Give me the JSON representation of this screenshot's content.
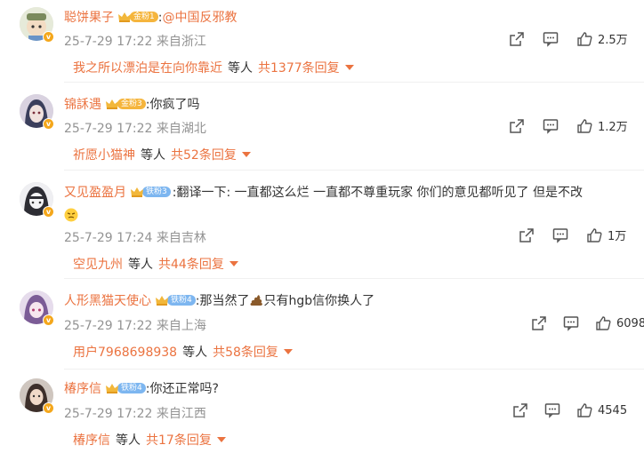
{
  "comments": [
    {
      "username": "聪饼果子",
      "fan_label": "金粉1",
      "fan_type": "gold",
      "text_prefix": ":",
      "mention": "@中国反邪教",
      "text_rest": "",
      "meta": "25-7-29 17:22 来自浙江",
      "likes": "2.5万",
      "reply_user": "我之所以漂泊是在向你靠近",
      "reply_mid": "等人",
      "reply_count": "共1377条回复",
      "avatar_color": "#b8c7a5",
      "badge": "gold"
    },
    {
      "username": "锦訸遇",
      "fan_label": "金粉3",
      "fan_type": "gold",
      "text_prefix": ":你疯了吗",
      "mention": "",
      "text_rest": "",
      "meta": "25-7-29 17:22 来自湖北",
      "likes": "1.2万",
      "reply_user": "祈愿小猫神",
      "reply_mid": "等人",
      "reply_count": "共52条回复",
      "avatar_color": "#3b3f5c",
      "badge": "gold"
    },
    {
      "username": "又见盈盈月",
      "fan_label": "铁粉3",
      "fan_type": "iron",
      "text_prefix": ":翻译一下:  一直都这么烂  一直都不尊重玩家  你们的意见都听见了  但是不改",
      "mention": "",
      "text_rest": "",
      "meta": "25-7-29 17:24 来自吉林",
      "likes": "1万",
      "reply_user": "空见九州",
      "reply_mid": "等人",
      "reply_count": "共44条回复",
      "avatar_color": "#cfcfd6",
      "badge": "gold"
    },
    {
      "username": "人形黑猫天使心",
      "fan_label": "铁粉4",
      "fan_type": "iron",
      "text_prefix": ":那当然了",
      "mention": "",
      "text_rest": "只有hgb信你换人了",
      "meta": "25-7-29 17:22 来自上海",
      "likes": "6098",
      "reply_user": "用户7968698938",
      "reply_mid": "等人",
      "reply_count": "共58条回复",
      "avatar_color": "#a58ab8",
      "badge": "gold"
    },
    {
      "username": "椿序信",
      "fan_label": "铁粉4",
      "fan_type": "iron",
      "text_prefix": ":你还正常吗?",
      "mention": "",
      "text_rest": "",
      "meta": "25-7-29 17:22 来自江西",
      "likes": "4545",
      "reply_user": "椿序信",
      "reply_mid": "等人",
      "reply_count": "共17条回复",
      "avatar_color": "#5c4b44",
      "badge": "gold"
    }
  ],
  "icons": {
    "share": "share-icon",
    "comment": "comment-icon",
    "like": "like-icon",
    "expand": "chevron-down-icon"
  },
  "colors": {
    "accent": "#eb7340",
    "meta": "#939393"
  }
}
